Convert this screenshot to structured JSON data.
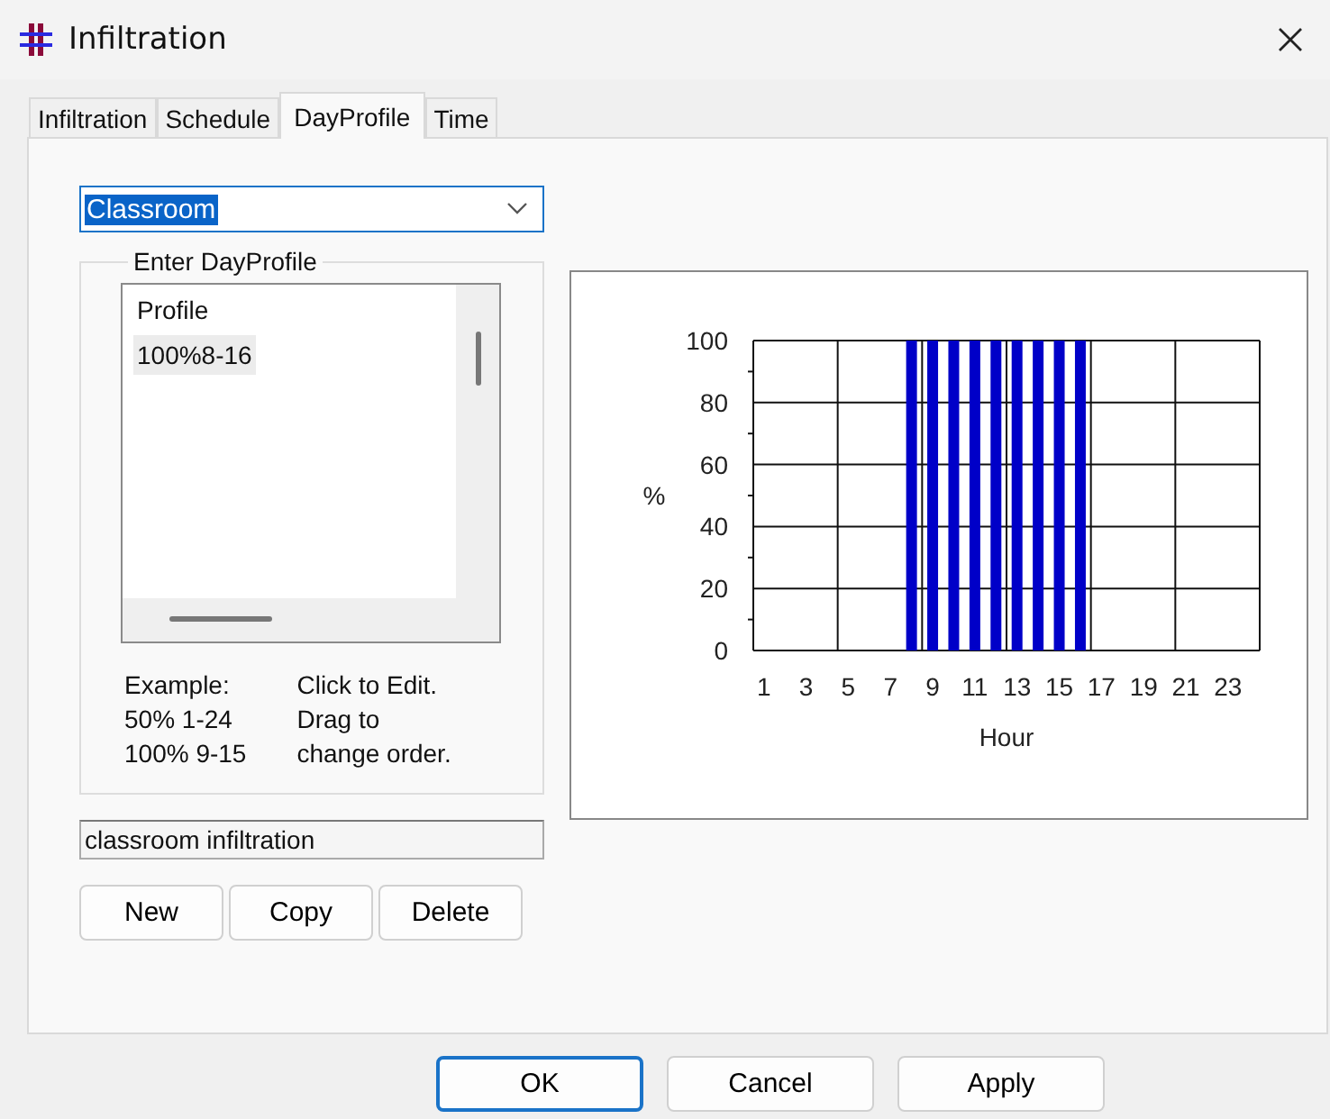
{
  "window": {
    "title": "Infiltration"
  },
  "tabs": [
    {
      "label": "Infiltration",
      "selected": false
    },
    {
      "label": "Schedule",
      "selected": false
    },
    {
      "label": "DayProfile",
      "selected": true
    },
    {
      "label": "Time",
      "selected": false
    }
  ],
  "profile_select": {
    "value": "Classroom",
    "selected": true
  },
  "group": {
    "title": "Enter DayProfile",
    "list_header": "Profile",
    "items": [
      {
        "text": "100%8-16",
        "selected": true
      }
    ],
    "example": "Example:\n50% 1-24\n100% 9-15",
    "hint": "Click to Edit.\nDrag to\nchange order."
  },
  "description": {
    "value": "classroom infiltration"
  },
  "list_buttons": [
    "New",
    "Copy",
    "Delete"
  ],
  "chart": {
    "chart_data": {
      "type": "bar",
      "xlabel": "Hour",
      "ylabel": "%",
      "x": [
        8,
        9,
        10,
        11,
        12,
        13,
        14,
        15,
        16
      ],
      "grid": true,
      "xlim": [
        0.5,
        24.5
      ],
      "values": [
        100,
        100,
        100,
        100,
        100,
        100,
        100,
        100,
        100
      ],
      "xticks": [
        1,
        3,
        5,
        7,
        9,
        11,
        13,
        15,
        17,
        19,
        21,
        23
      ],
      "yticks": [
        0,
        20,
        40,
        60,
        80,
        100
      ],
      "ylim": [
        0,
        100
      ]
    }
  },
  "dialog_buttons": [
    {
      "label": "OK",
      "default": true
    },
    {
      "label": "Cancel",
      "default": false
    },
    {
      "label": "Apply",
      "default": false
    }
  ]
}
